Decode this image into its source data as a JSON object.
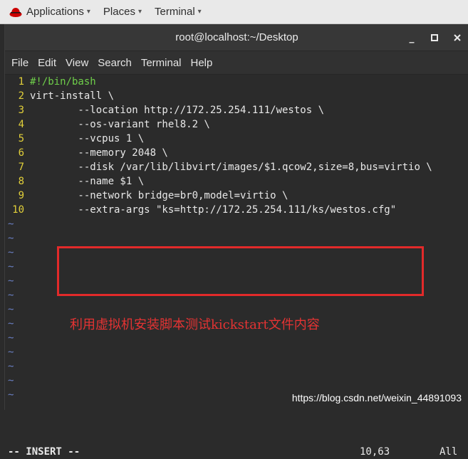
{
  "topbar": {
    "applications": "Applications",
    "places": "Places",
    "terminal": "Terminal"
  },
  "window": {
    "title": "root@localhost:~/Desktop",
    "minimize": "_",
    "maximize": "▫",
    "close": "×"
  },
  "menu": [
    "File",
    "Edit",
    "View",
    "Search",
    "Terminal",
    "Help"
  ],
  "editor": {
    "lines": [
      {
        "num": "1",
        "text": "#!/bin/bash"
      },
      {
        "num": "2",
        "text": "virt-install \\"
      },
      {
        "num": "3",
        "text": "        --location http://172.25.254.111/westos \\"
      },
      {
        "num": "4",
        "text": "        --os-variant rhel8.2 \\"
      },
      {
        "num": "5",
        "text": "        --vcpus 1 \\"
      },
      {
        "num": "6",
        "text": "        --memory 2048 \\"
      },
      {
        "num": "7",
        "text": "        --disk /var/lib/libvirt/images/$1.qcow2,size=8,bus=virtio \\"
      },
      {
        "num": "8",
        "text": "        --name $1 \\"
      },
      {
        "num": "9",
        "text": "        --network bridge=br0,model=virtio \\"
      },
      {
        "num": "10",
        "text": "        --extra-args \"ks=http://172.25.254.111/ks/westos.cfg\""
      }
    ],
    "tilde": "~",
    "mode": "-- INSERT --",
    "position": "10,63",
    "scroll": "All"
  },
  "annotation": "利用虚拟机安装脚本测试kickstart文件内容",
  "watermark": "https://blog.csdn.net/weixin_44891093",
  "colors": {
    "line_number": "#e2d03a",
    "shebang": "#6fcf4a",
    "annotation_red": "#e43333",
    "box_red": "#e22a2a"
  }
}
